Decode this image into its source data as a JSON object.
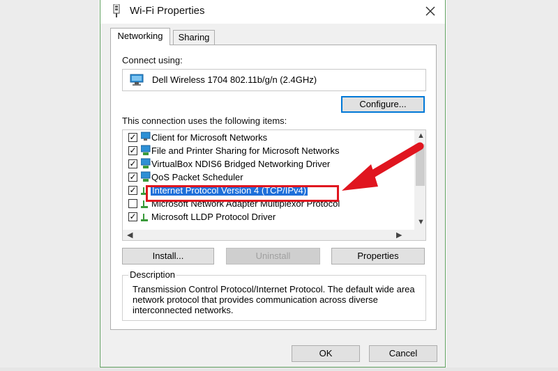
{
  "window": {
    "title": "Wi-Fi Properties"
  },
  "tabs": [
    {
      "label": "Networking",
      "active": true
    },
    {
      "label": "Sharing",
      "active": false
    }
  ],
  "connect_using": {
    "label": "Connect using:",
    "adapter": "Dell Wireless 1704 802.11b/g/n (2.4GHz)",
    "configure_button": "Configure..."
  },
  "items_section": {
    "label": "This connection uses the following items:",
    "items": [
      {
        "label": "Client for Microsoft Networks",
        "checked": true,
        "selected": false,
        "icon": "network-client-icon"
      },
      {
        "label": "File and Printer Sharing for Microsoft Networks",
        "checked": true,
        "selected": false,
        "icon": "network-service-icon"
      },
      {
        "label": "VirtualBox NDIS6 Bridged Networking Driver",
        "checked": true,
        "selected": false,
        "icon": "network-service-icon"
      },
      {
        "label": "QoS Packet Scheduler",
        "checked": true,
        "selected": false,
        "icon": "network-service-icon"
      },
      {
        "label": "Internet Protocol Version 4 (TCP/IPv4)",
        "checked": true,
        "selected": true,
        "icon": "protocol-icon"
      },
      {
        "label": "Microsoft Network Adapter Multiplexor Protocol",
        "checked": false,
        "selected": false,
        "icon": "protocol-icon"
      },
      {
        "label": "Microsoft LLDP Protocol Driver",
        "checked": true,
        "selected": false,
        "icon": "protocol-icon"
      }
    ]
  },
  "buttons": {
    "install": "Install...",
    "uninstall": "Uninstall",
    "properties": "Properties",
    "ok": "OK",
    "cancel": "Cancel"
  },
  "description": {
    "title": "Description",
    "text": "Transmission Control Protocol/Internet Protocol. The default wide area network protocol that provides communication across diverse interconnected networks."
  },
  "colors": {
    "selection": "#1e6fd9",
    "annotation": "#e0151f",
    "focus": "#0078d7"
  }
}
